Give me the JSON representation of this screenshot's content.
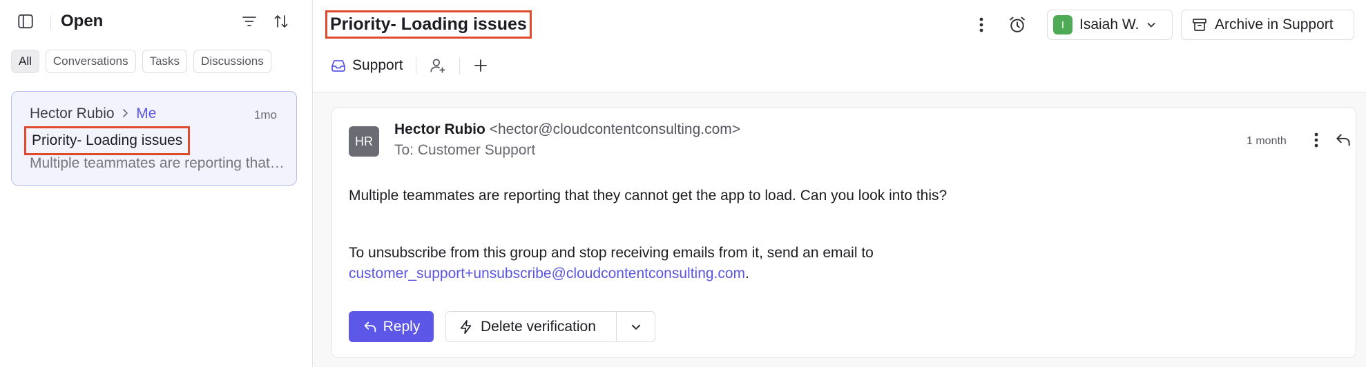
{
  "list": {
    "title": "Open",
    "chips": [
      "All",
      "Conversations",
      "Tasks",
      "Discussions"
    ],
    "conversation": {
      "from": "Hector Rubio",
      "to": "Me",
      "time": "1mo",
      "subject": "Priority- Loading issues",
      "preview": "Multiple teammates are reporting that they cannot get the app to load. Can you look into this?"
    }
  },
  "header": {
    "title": "Priority- Loading issues",
    "assignee_initial": "I",
    "assignee_name": "Isaiah W.",
    "archive_label": "Archive in Support",
    "inbox_label": "Support"
  },
  "message": {
    "avatar_initials": "HR",
    "sender_name": "Hector Rubio",
    "sender_email": "<hector@cloudcontentconsulting.com>",
    "recipient": "To: Customer Support",
    "time": "1 month",
    "body": "Multiple teammates are reporting that they cannot get the app to load. Can you look into this?",
    "unsubscribe_text": "To unsubscribe from this group and stop receiving emails from it, send an email to",
    "unsubscribe_email": "customer_support+unsubscribe@cloudcontentconsulting.com",
    "unsubscribe_period": "."
  },
  "actions": {
    "reply_label": "Reply",
    "rule_label": "Delete verification"
  },
  "colors": {
    "accent": "#5c57e6",
    "highlight_border": "#e04a2c",
    "assignee_avatar": "#4faa56",
    "selected_card_bg": "#f2f3fd"
  }
}
